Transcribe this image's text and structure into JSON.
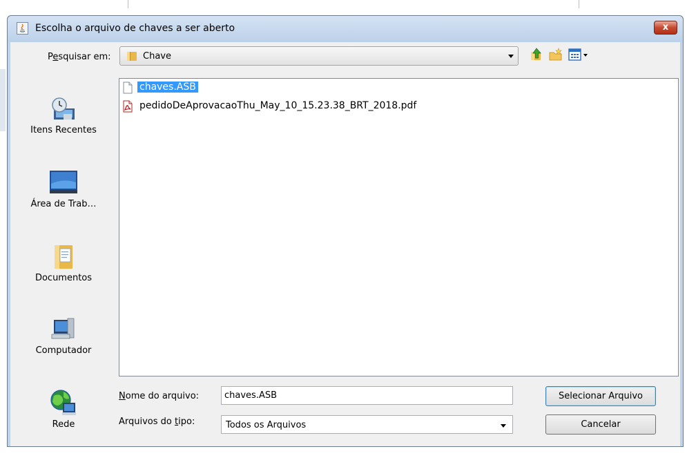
{
  "dialog": {
    "title": "Escolha o arquivo de chaves a ser aberto",
    "close_label": "x"
  },
  "lookin": {
    "label_accel": "e",
    "label_pre": "P",
    "label_post": "squisar em:",
    "value": "Chave"
  },
  "toolbar": {
    "up_icon": "folder-up-icon",
    "new_folder_icon": "new-folder-icon",
    "views_icon": "view-menu-icon"
  },
  "places": [
    {
      "label": "Itens Recentes",
      "icon": "recent-items-icon"
    },
    {
      "label": "Área de Trab…",
      "icon": "desktop-icon"
    },
    {
      "label": "Documentos",
      "icon": "documents-icon"
    },
    {
      "label": "Computador",
      "icon": "computer-icon"
    },
    {
      "label": "Rede",
      "icon": "network-icon"
    }
  ],
  "files": [
    {
      "name": "chaves.ASB",
      "icon": "file-icon",
      "selected": true
    },
    {
      "name": "pedidoDeAprovacaoThu_May_10_15.23.38_BRT_2018.pdf",
      "icon": "pdf-icon",
      "selected": false
    }
  ],
  "filename": {
    "label_accel": "N",
    "label_rest": "ome do arquivo:",
    "value": "chaves.ASB"
  },
  "filetype": {
    "label_pre": "Arquivos do ",
    "label_accel": "t",
    "label_post": "ipo:",
    "value": "Todos os Arquivos"
  },
  "buttons": {
    "open": "Selecionar Arquivo",
    "cancel": "Cancelar"
  },
  "colors": {
    "selection": "#3399ff",
    "window_frame": "#bfd3ea",
    "close_button": "#c64a31"
  }
}
